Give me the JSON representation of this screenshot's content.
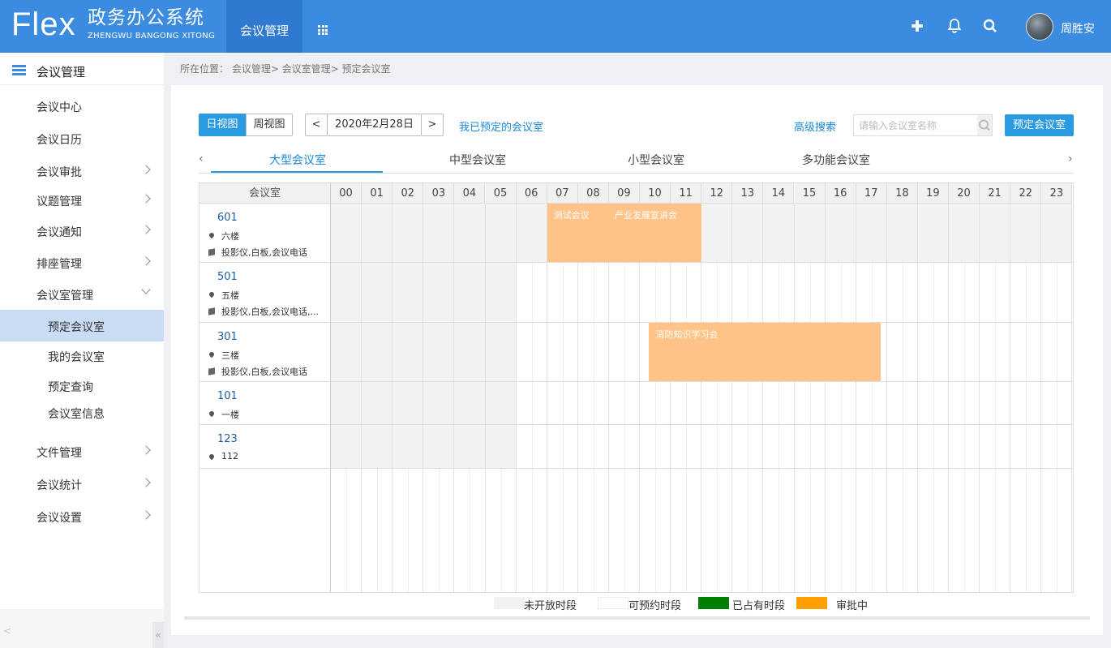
{
  "header": {
    "logo_mark": "Flex",
    "logo_cn": "政务办公系统",
    "logo_en": "ZHENGWU BANGONG XITONG",
    "active_tab": "会议管理",
    "user_name": "周胜安",
    "icons": [
      "apps-icon",
      "plus-icon",
      "bell-icon",
      "search-icon"
    ]
  },
  "sidebar": {
    "title": "会议管理",
    "items": [
      {
        "label": "会议中心"
      },
      {
        "label": "会议日历"
      },
      {
        "label": "会议审批"
      },
      {
        "label": "议题管理"
      },
      {
        "label": "会议通知"
      },
      {
        "label": "排座管理"
      },
      {
        "label": "会议室管理"
      },
      {
        "label": "预定会议室"
      },
      {
        "label": "我的会议室"
      },
      {
        "label": "预定查询"
      },
      {
        "label": "会议室信息"
      },
      {
        "label": "文件管理"
      },
      {
        "label": "会议统计"
      },
      {
        "label": "会议设置"
      }
    ],
    "collapse_left": "<",
    "collapse_right": "«"
  },
  "breadcrumb": "所在位置：  会议管理>  会议室管理>  预定会议室",
  "toolbar": {
    "day_view": "日视图",
    "week_view": "周视图",
    "prev": "<",
    "date": "2020年2月28日",
    "next": ">",
    "my_booked": "我已预定的会议室",
    "advanced_search": "高级搜索",
    "search_placeholder": "请输入会议室名称",
    "book_button": "预定会议室"
  },
  "room_types": {
    "prev": "‹",
    "next": "›",
    "tabs": [
      "大型会议室",
      "中型会议室",
      "小型会议室",
      "多功能会议室"
    ],
    "active": "大型会议室"
  },
  "schedule": {
    "room_header": "会议室",
    "hours": [
      "00",
      "01",
      "02",
      "03",
      "04",
      "05",
      "06",
      "07",
      "08",
      "09",
      "10",
      "11",
      "12",
      "13",
      "14",
      "15",
      "16",
      "17",
      "18",
      "19",
      "20",
      "21",
      "22",
      "23"
    ],
    "rooms": [
      {
        "number": "601",
        "floor": "六楼",
        "devices": "投影仪,白板,会议电话"
      },
      {
        "number": "501",
        "floor": "五楼",
        "devices": "投影仪,白板,会议电话,..."
      },
      {
        "number": "301",
        "floor": "三楼",
        "devices": "投影仪,白板,会议电话"
      },
      {
        "number": "101",
        "floor": "一楼",
        "devices": ""
      },
      {
        "number": "123",
        "floor": "112",
        "devices": ""
      }
    ],
    "bookings": [
      {
        "title": "测试会议",
        "room": "601"
      },
      {
        "title": "产业发展宣讲会",
        "room": "601"
      },
      {
        "title": "消防知识学习会",
        "room": "301"
      }
    ]
  },
  "legend": [
    {
      "label": "未开放时段",
      "color": "#f2f2f2"
    },
    {
      "label": "可预约时段",
      "color": "#ffffff"
    },
    {
      "label": "已占有时段",
      "color": "#008000"
    },
    {
      "label": "审批中",
      "color": "#ff9f00"
    }
  ],
  "colors": {
    "header": "#3b8be0",
    "accent": "#2a9be0",
    "booking": "#ffc387"
  }
}
